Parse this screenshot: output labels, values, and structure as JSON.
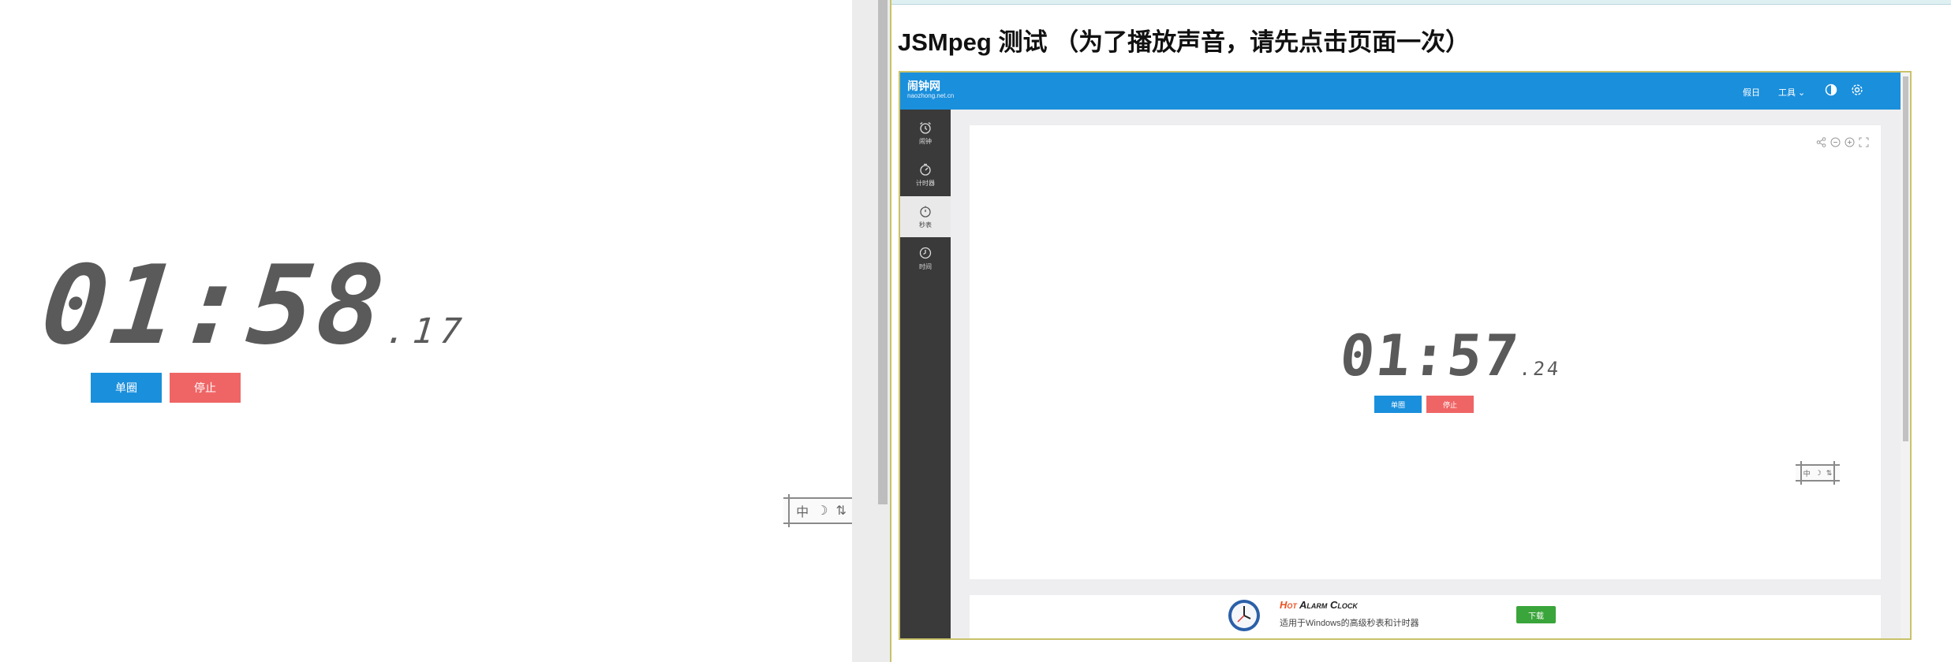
{
  "left": {
    "time_main": "01:58",
    "time_frac": ".17",
    "lap_label": "单圈",
    "stop_label": "停止",
    "stamp_glyphs": [
      "中",
      "☽",
      "⇅"
    ]
  },
  "right": {
    "heading": "JSMpeg 测试 （为了播放声音，请先点击页面一次）",
    "brand": {
      "name": "闹钟网",
      "domain": "naozhong.net.cn"
    },
    "nav": {
      "holiday": "假日",
      "tools": "工具 ⌄"
    },
    "icons": {
      "theme": "contrast-icon",
      "settings": "gear-icon"
    },
    "sidebar": {
      "items": [
        {
          "label": "闹钟",
          "icon": "alarm-clock-icon",
          "active": false
        },
        {
          "label": "计时器",
          "icon": "timer-icon",
          "active": false
        },
        {
          "label": "秒表",
          "icon": "stopwatch-icon",
          "active": true
        },
        {
          "label": "时间",
          "icon": "clock-icon",
          "active": false
        }
      ]
    },
    "card_tools": [
      "share-icon",
      "zoom-out-icon",
      "zoom-in-icon",
      "fullscreen-icon"
    ],
    "time_main": "01:57",
    "time_frac": ".24",
    "lap_label": "单圈",
    "stop_label": "停止",
    "stamp_glyphs": [
      "中",
      "☽",
      "⇅"
    ],
    "ad": {
      "title_hot": "Hot",
      "title_rest": " Alarm Clock",
      "description": "适用于Windows的高级秒表和计时器",
      "download_label": "下载"
    }
  },
  "colors": {
    "accent_blue": "#1a8fdc",
    "stop_red": "#ef6566",
    "sidebar_dark": "#3a3a3a",
    "digit_gray": "#5a5a5a"
  }
}
